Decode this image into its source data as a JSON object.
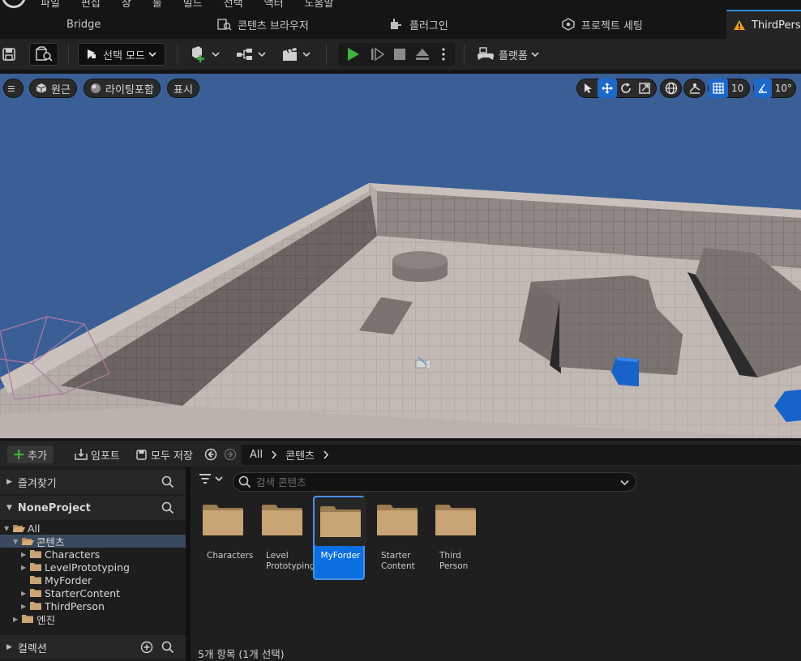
{
  "menu": [
    "파일",
    "편집",
    "창",
    "툴",
    "빌드",
    "선택",
    "액터",
    "도움말"
  ],
  "tabs": [
    {
      "label": "Bridge"
    },
    {
      "label": "콘텐츠 브라우저"
    },
    {
      "label": "플러그인"
    },
    {
      "label": "프로젝트 세팅"
    },
    {
      "label": "ThirdPers",
      "active": true
    }
  ],
  "toolbar": {
    "select_mode": "선택 모드",
    "platform": "플랫폼"
  },
  "viewport": {
    "perspective": "원근",
    "lighting": "라이팅포함",
    "show": "표시",
    "grid_snap": "10",
    "rotation_snap": "10°"
  },
  "content_browser": {
    "add": "추가",
    "import": "임포트",
    "save_all": "모두 저장",
    "breadcrumb": [
      "All",
      "콘텐츠"
    ],
    "favorites": "즐겨찾기",
    "project": "NoneProject",
    "collections": "컬렉션",
    "search_placeholder": "검색 콘텐츠",
    "tree": {
      "root": "All",
      "content": "콘텐츠",
      "children": [
        "Characters",
        "LevelPrototyping",
        "MyForder",
        "StarterContent",
        "ThirdPerson"
      ],
      "engine": "엔진"
    },
    "assets": [
      {
        "line1": "Characters",
        "line2": ""
      },
      {
        "line1": "Level",
        "line2": "Prototyping"
      },
      {
        "line1": "MyForder",
        "line2": "",
        "selected": true
      },
      {
        "line1": "Starter",
        "line2": "Content"
      },
      {
        "line1": "Third",
        "line2": "Person"
      }
    ],
    "status": "5개 항목 (1개 선택)"
  },
  "colors": {
    "accent": "#0a6fe0",
    "play": "#3fb13f",
    "folder": "#c9a474",
    "sky": "#3a5f97"
  }
}
